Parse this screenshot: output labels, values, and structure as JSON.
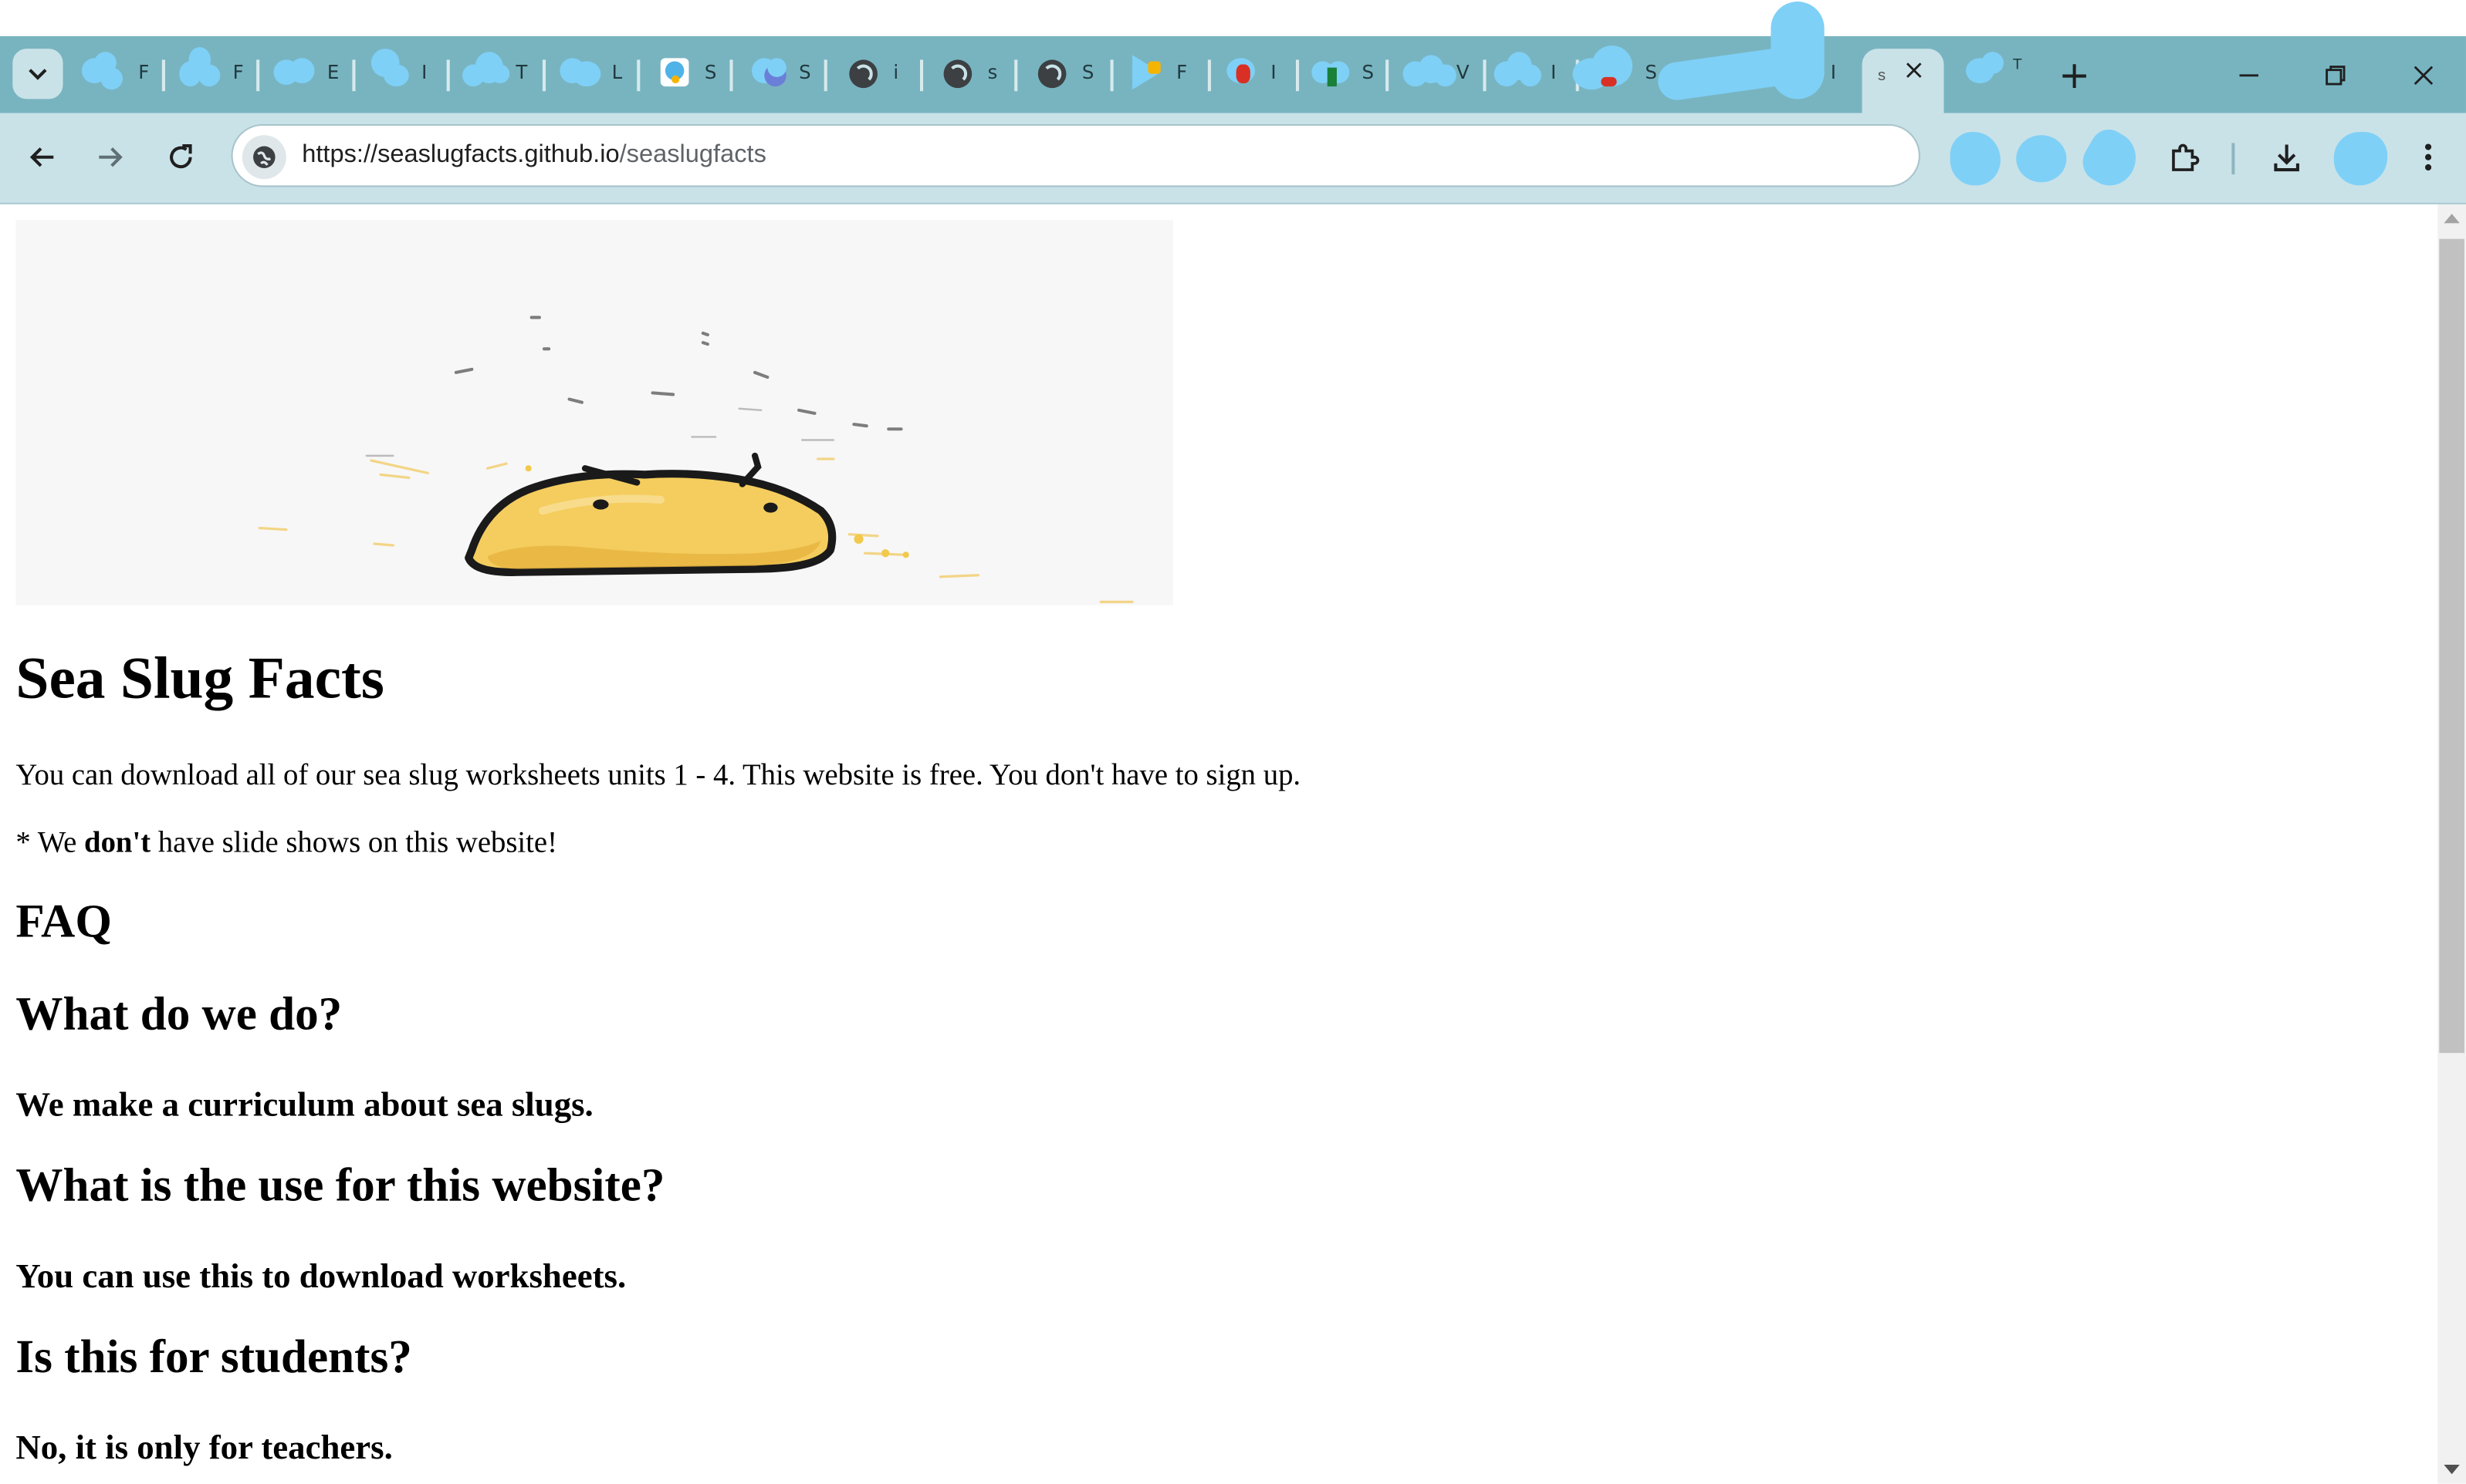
{
  "browser": {
    "address_bar": {
      "url_host": "https://seaslugfacts.github.io",
      "url_path": "/seaslugfacts"
    },
    "tab_strip": {
      "tab_chars": [
        "F",
        "F",
        "E",
        "I",
        "T",
        "L",
        "S",
        "S",
        "i",
        "s",
        "S",
        "F",
        "I",
        "S",
        "V",
        "I",
        "S",
        "I"
      ],
      "active_tab_char": "s",
      "partial_tab_char": "T"
    },
    "colors": {
      "tabbar": "#78b4c0",
      "toolbar": "#c9e2e8",
      "redaction": "#7fd0f7"
    }
  },
  "page": {
    "hero_image": "yellow-sea-slug-drawing",
    "title": "Sea Slug Facts",
    "intro": "You can download all of our sea slug worksheets units 1 - 4. This website is free. You don't have to sign up.",
    "note": {
      "prefix": "* We ",
      "emphasis": "don't",
      "suffix": " have slide shows on this website!"
    },
    "faq_heading": "FAQ",
    "faq": [
      {
        "question": "What do we do?",
        "answer": "We make a curriculum about sea slugs."
      },
      {
        "question": "What is the use for this website?",
        "answer": "You can use this to download worksheets."
      },
      {
        "question": "Is this for students?",
        "answer": "No, it is only for teachers."
      }
    ]
  }
}
